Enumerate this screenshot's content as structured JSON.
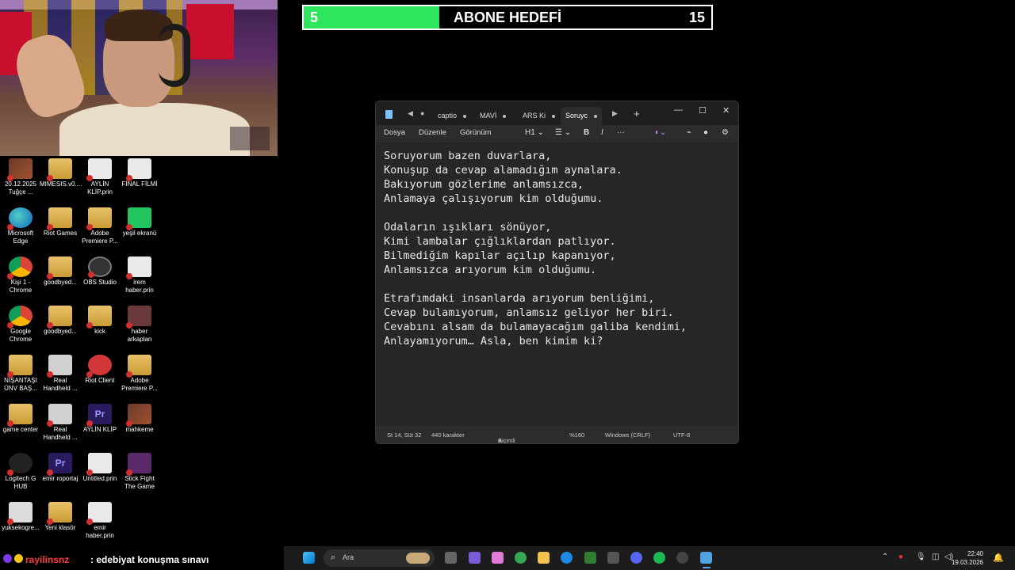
{
  "goal": {
    "current": "5",
    "title": "ABONE HEDEFİ",
    "target": "15",
    "progress_fraction": 0.333,
    "fill_color": "#2ee65e"
  },
  "desktop_icons": [
    {
      "label": "20.12.2025 Tuğçe ...",
      "icon": "photo",
      "col": 0,
      "row": 0
    },
    {
      "label": "MIMESIS.v0....",
      "icon": "folder",
      "col": 1,
      "row": 0
    },
    {
      "label": "AYLİN KLİP.prin",
      "icon": "doc",
      "col": 2,
      "row": 0
    },
    {
      "label": "FİNAL FİLMİ",
      "icon": "doc",
      "col": 3,
      "row": 0
    },
    {
      "label": "Microsoft Edge",
      "icon": "edge",
      "col": 0,
      "row": 1
    },
    {
      "label": "Riot Games",
      "icon": "folder",
      "col": 1,
      "row": 1
    },
    {
      "label": "Adobe Premiere P...",
      "icon": "folder",
      "col": 2,
      "row": 1
    },
    {
      "label": "yeşil ekranü",
      "icon": "green",
      "col": 3,
      "row": 1
    },
    {
      "label": "Kişi 1 - Chrome",
      "icon": "chrome",
      "col": 0,
      "row": 2
    },
    {
      "label": "goodbyed...",
      "icon": "folder",
      "col": 1,
      "row": 2
    },
    {
      "label": "OBS Studio",
      "icon": "obs",
      "col": 2,
      "row": 2
    },
    {
      "label": "irem haber.prin",
      "icon": "doc",
      "col": 3,
      "row": 2
    },
    {
      "label": "Google Chrome",
      "icon": "chrome",
      "col": 0,
      "row": 3
    },
    {
      "label": "goodbyed...",
      "icon": "folder",
      "col": 1,
      "row": 3
    },
    {
      "label": "kick",
      "icon": "folder",
      "col": 2,
      "row": 3
    },
    {
      "label": "haber arkaplan",
      "icon": "dark",
      "col": 3,
      "row": 3
    },
    {
      "label": "NİŞANTAŞI ÜNV BAŞ...",
      "icon": "folder",
      "col": 0,
      "row": 4
    },
    {
      "label": "Real Handheld ...",
      "icon": "set",
      "col": 1,
      "row": 4
    },
    {
      "label": "Riot Client",
      "icon": "riot",
      "col": 2,
      "row": 4
    },
    {
      "label": "Adobe Premiere P...",
      "icon": "folder",
      "col": 3,
      "row": 4
    },
    {
      "label": "game center",
      "icon": "folder",
      "col": 0,
      "row": 5
    },
    {
      "label": "Real Handheld ...",
      "icon": "set",
      "col": 1,
      "row": 5
    },
    {
      "label": "AYLİN KLİP",
      "icon": "pr",
      "col": 2,
      "row": 5
    },
    {
      "label": "mahkeme",
      "icon": "photo",
      "col": 3,
      "row": 5
    },
    {
      "label": "Logitech G HUB",
      "icon": "logi",
      "col": 0,
      "row": 6
    },
    {
      "label": "emir roportaj",
      "icon": "pr",
      "col": 1,
      "row": 6
    },
    {
      "label": "Untitled.prin",
      "icon": "doc",
      "col": 2,
      "row": 6
    },
    {
      "label": "Stick Fight The Game",
      "icon": "stick",
      "col": 3,
      "row": 6
    },
    {
      "label": "yuksekogre...",
      "icon": "sheet",
      "col": 0,
      "row": 7
    },
    {
      "label": "Yeni klasör",
      "icon": "folder",
      "col": 1,
      "row": 7
    },
    {
      "label": "emir haber.prin",
      "icon": "doc",
      "col": 2,
      "row": 7
    }
  ],
  "notepad": {
    "tabs": [
      "captio",
      "MAVİ",
      "ARS Ki",
      "Soruyc"
    ],
    "active_tab": "Soruyc",
    "menu": [
      "Dosya",
      "Düzenle",
      "Görünüm"
    ],
    "toolbar": {
      "heading": "H1",
      "bold": "B",
      "italic": "I",
      "more": "···"
    },
    "stanzas": [
      [
        "Soruyorum bazen duvarlara,",
        "Konuşup da cevap alamadığım aynalara.",
        "Bakıyorum gözlerime anlamsızca,",
        "Anlamaya çalışıyorum kim olduğumu."
      ],
      [
        "Odaların ışıkları sönüyor,",
        "Kimi lambalar çığlıklardan patlıyor.",
        "Bilmediğim kapılar açılıp kapanıyor,",
        "Anlamsızca arıyorum kim olduğumu."
      ],
      [
        "Etrafımdaki insanlarda arıyorum benliğimi,",
        "Cevap bulamıyorum, anlamsız geliyor her biri.",
        "Cevabını alsam da bulamayacağım galiba kendimi,",
        "Anlayamıyorum… Asla, ben kimim ki?"
      ]
    ],
    "status": {
      "position": "St 14, Süt 32",
      "chars": "440 karakter",
      "format": "Biçimli",
      "zoom": "%160",
      "line_ending": "Windows (CRLF)",
      "encoding": "UTF-8"
    }
  },
  "chat": {
    "user": "rayilinsnz",
    "message": ": edebiyat konuşma sınavı"
  },
  "taskbar": {
    "search_placeholder": "Ara",
    "time": "22:40",
    "date": "19.03.2026"
  }
}
